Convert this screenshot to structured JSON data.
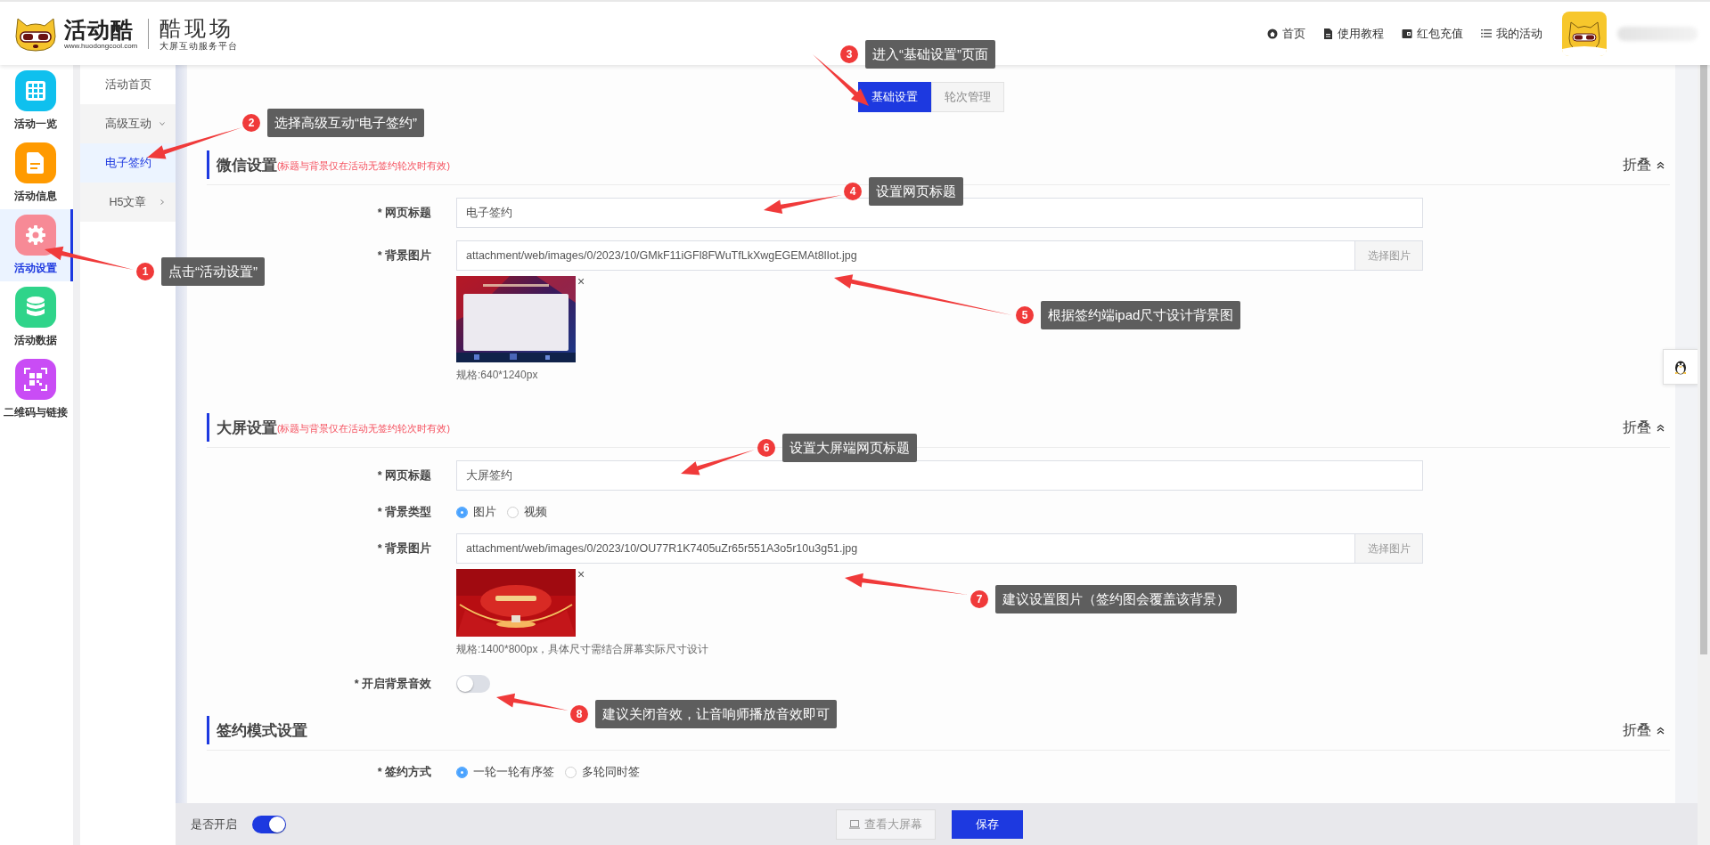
{
  "header": {
    "logo": {
      "brand": "活动酷",
      "url": "www.huodongcool.com",
      "product": "酷现场",
      "slogan": "大屏互动服务平台"
    },
    "nav": [
      {
        "label": "首页"
      },
      {
        "label": "使用教程"
      },
      {
        "label": "红包充值"
      },
      {
        "label": "我的活动"
      }
    ]
  },
  "sidebar": {
    "items": [
      {
        "label": "活动一览",
        "color": "#0fc0ee",
        "selected": false
      },
      {
        "label": "活动信息",
        "color": "#ff9a00",
        "selected": false
      },
      {
        "label": "活动设置",
        "color": "#f78a96",
        "selected": true
      },
      {
        "label": "活动数据",
        "color": "#2fd48a",
        "selected": false
      },
      {
        "label": "二维码与链接",
        "color": "#c94cf5",
        "selected": false
      }
    ]
  },
  "submenu": {
    "items": [
      {
        "kind": "item",
        "label": "活动首页",
        "selected": false
      },
      {
        "kind": "group",
        "label": "高级互动",
        "selected": false,
        "expanded": true
      },
      {
        "kind": "item",
        "label": "电子签约",
        "selected": true
      },
      {
        "kind": "group",
        "label": "H5文章",
        "selected": false,
        "expanded": false
      }
    ]
  },
  "tabs": [
    {
      "label": "基础设置",
      "selected": true
    },
    {
      "label": "轮次管理",
      "selected": false
    }
  ],
  "sections": [
    {
      "title": "微信设置",
      "note": "(标题与背景仅在活动无签约轮次时有效)",
      "collapse": "折叠",
      "fields": [
        {
          "kind": "text",
          "label": "* 网页标题",
          "value": "电子签约"
        },
        {
          "label": "* 背景图片",
          "value": "attachment/web/images/0/2023/10/GMkF11iGFl8FWuTfLkXwgEGEMAt8lIot.jpg",
          "button": "选择图片",
          "remove": "×",
          "spec": "规格:640*1240px"
        }
      ]
    },
    {
      "title": "大屏设置",
      "note": "(标题与背景仅在活动无签约轮次时有效)",
      "collapse": "折叠",
      "fields": [
        {
          "kind": "text",
          "label": "* 网页标题",
          "value": "大屏签约"
        },
        {
          "kind": "radio",
          "label": "* 背景类型",
          "options": [
            {
              "label": "图片",
              "selected": true
            },
            {
              "label": "视频",
              "selected": false
            }
          ]
        },
        {
          "label": "* 背景图片",
          "value": "attachment/web/images/0/2023/10/OU77R1K7405uZr65r551A3o5r10u3g51.jpg",
          "button": "选择图片",
          "remove": "×",
          "spec": "规格:1400*800px，具体尺寸需结合屏幕实际尺寸设计"
        },
        {
          "kind": "switch",
          "label": "* 开启背景音效",
          "on": false
        }
      ]
    },
    {
      "title": "签约模式设置",
      "collapse": "折叠",
      "fields": [
        {
          "kind": "radio",
          "label": "* 签约方式",
          "options": [
            {
              "label": "一轮一轮有序签",
              "selected": true
            },
            {
              "label": "多轮同时签",
              "selected": false
            }
          ]
        }
      ]
    }
  ],
  "footer": {
    "switch_label": "是否开启",
    "on": true,
    "preview_button": "查看大屏幕",
    "save_button": "保存"
  },
  "annotations": [
    {
      "number": "1",
      "text": "点击“活动设置”"
    },
    {
      "number": "2",
      "text": "选择高级互动“电子签约”"
    },
    {
      "number": "3",
      "text": "进入“基础设置”页面"
    },
    {
      "number": "4",
      "text": "设置网页标题"
    },
    {
      "number": "5",
      "text": "根据签约端ipad尺寸设计背景图"
    },
    {
      "number": "6",
      "text": "设置大屏端网页标题"
    },
    {
      "number": "7",
      "text": "建议设置图片（签约图会覆盖该背景）"
    },
    {
      "number": "8",
      "text": "建议关闭音效，让音响师播放音效即可"
    }
  ]
}
